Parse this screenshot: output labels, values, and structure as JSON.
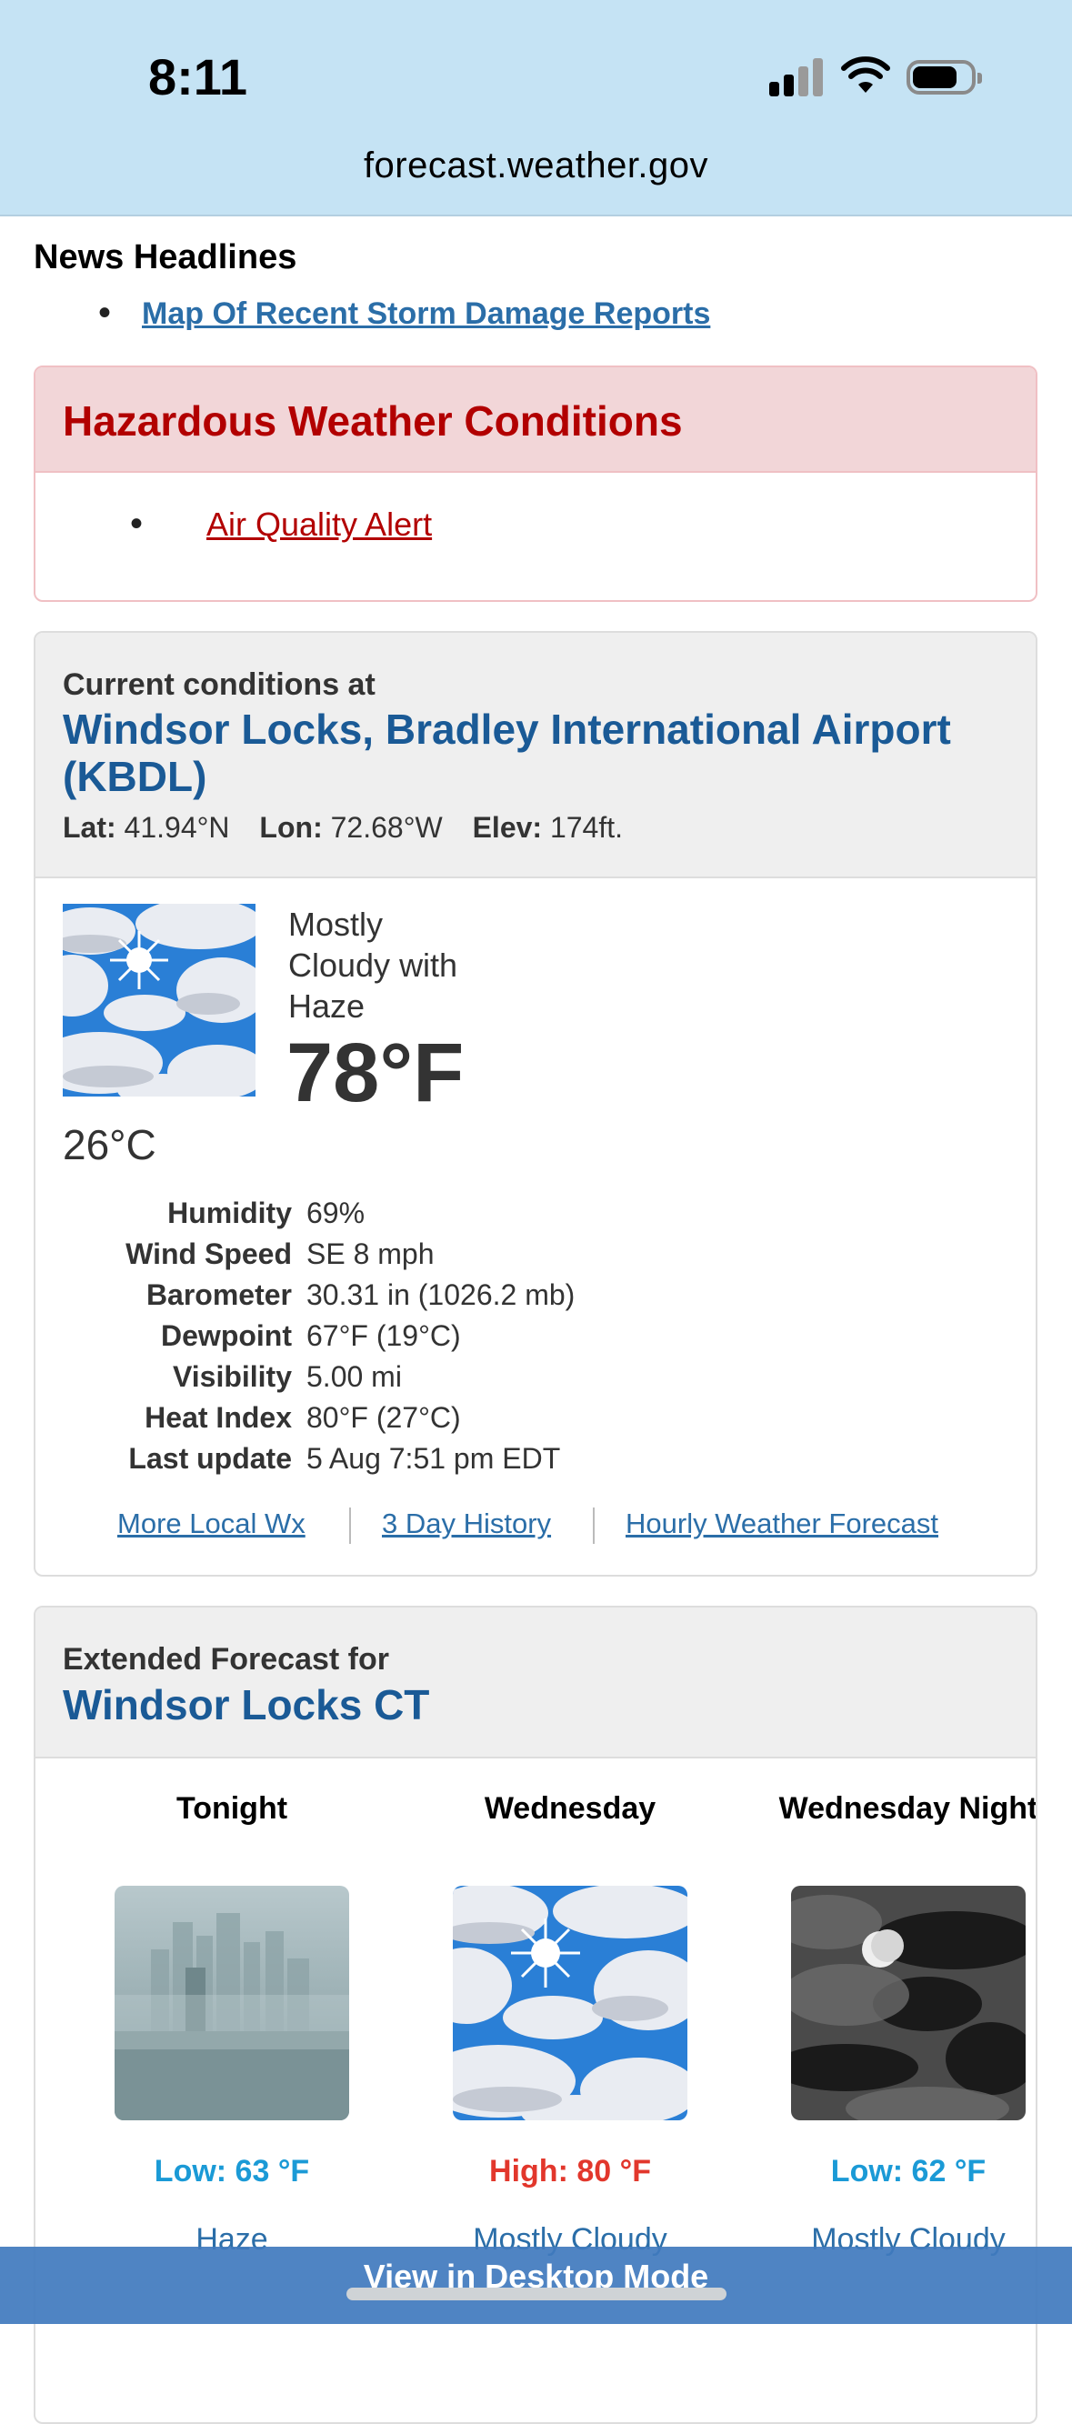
{
  "status_bar": {
    "time": "8:11"
  },
  "browser": {
    "url": "forecast.weather.gov"
  },
  "news": {
    "title": "News Headlines",
    "items": [
      "Map Of Recent Storm Damage Reports"
    ]
  },
  "hazard": {
    "title": "Hazardous Weather Conditions",
    "items": [
      "Air Quality Alert"
    ]
  },
  "current": {
    "label": "Current conditions at",
    "station": "Windsor Locks, Bradley International Airport (KBDL)",
    "lat_label": "Lat:",
    "lat": "41.94°N",
    "lon_label": "Lon:",
    "lon": "72.68°W",
    "elev_label": "Elev:",
    "elev": "174ft.",
    "description": [
      "Mostly",
      "Cloudy with",
      "Haze"
    ],
    "temp_f": "78°F",
    "temp_c": "26°C",
    "details": [
      {
        "label": "Humidity",
        "value": "69%"
      },
      {
        "label": "Wind Speed",
        "value": "SE 8 mph"
      },
      {
        "label": "Barometer",
        "value": "30.31 in (1026.2 mb)"
      },
      {
        "label": "Dewpoint",
        "value": "67°F (19°C)"
      },
      {
        "label": "Visibility",
        "value": "5.00 mi"
      },
      {
        "label": "Heat Index",
        "value": "80°F (27°C)"
      },
      {
        "label": "Last update",
        "value": "5 Aug 7:51 pm EDT"
      }
    ],
    "links": [
      "More Local Wx",
      "3 Day History",
      "Hourly Weather Forecast"
    ]
  },
  "extended": {
    "label": "Extended Forecast for",
    "place": "Windsor Locks CT",
    "periods": [
      {
        "name": "Tonight",
        "temp": "Low: 63 °F",
        "short": "Haze",
        "kind": "low",
        "icon": "haze-icon"
      },
      {
        "name": "Wednesday",
        "temp": "High: 80 °F",
        "short": "Mostly Cloudy",
        "kind": "high",
        "icon": "mostly-cloudy-icon"
      },
      {
        "name": "Wednesday Night",
        "temp": "Low: 62 °F",
        "short": "Mostly Cloudy",
        "kind": "low",
        "icon": "night-cloudy-icon"
      }
    ]
  },
  "bottom_bar": {
    "label": "View in Desktop Mode"
  },
  "colors": {
    "link": "#2b6ea8",
    "hazard": "#b20000",
    "low": "#1b9ad6",
    "high": "#e2372c",
    "title": "#1a5a96"
  }
}
